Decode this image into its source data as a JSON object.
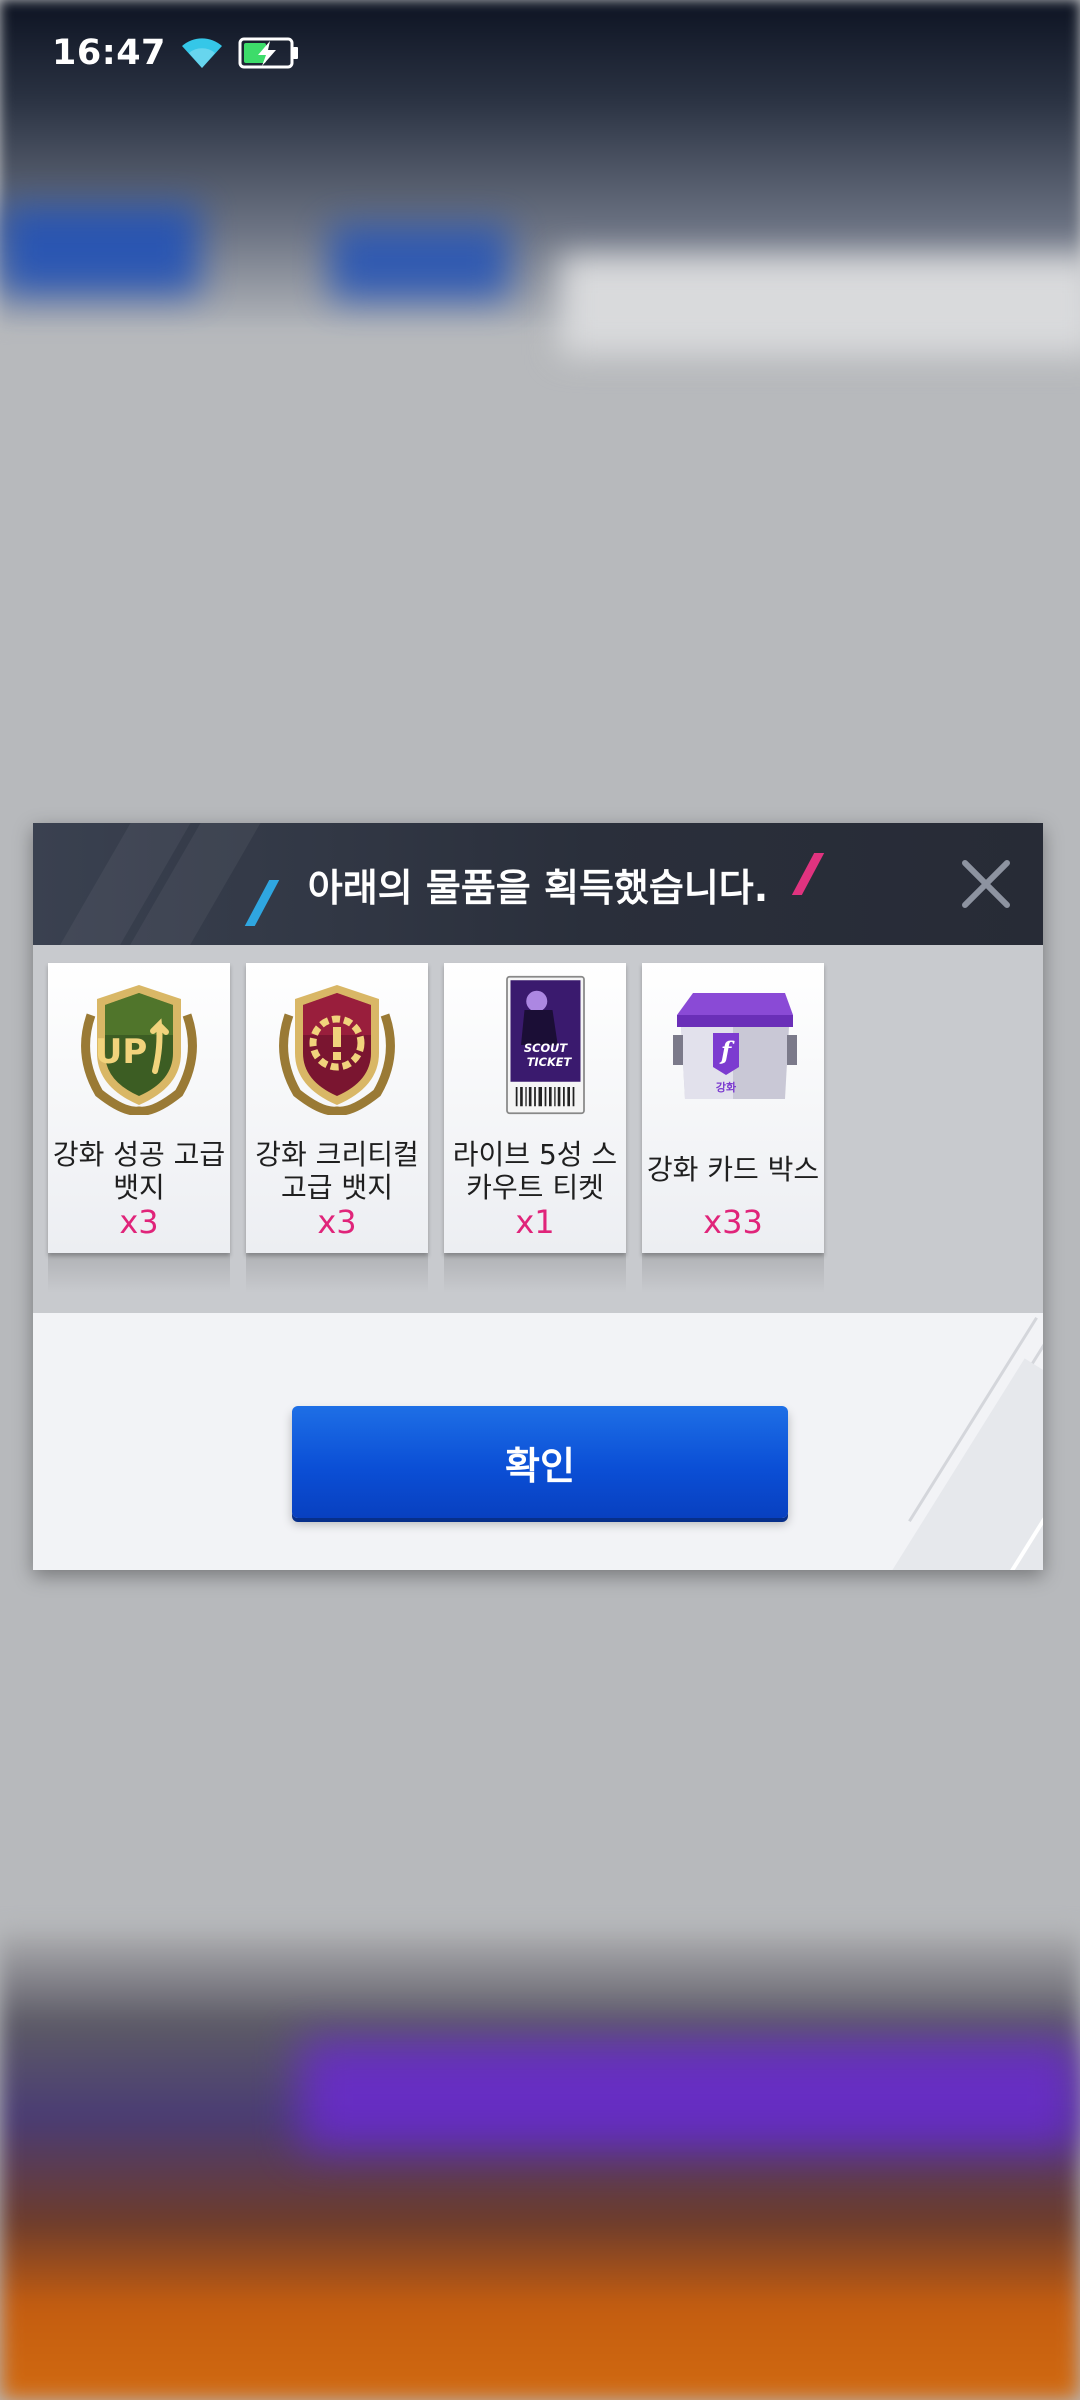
{
  "status_bar": {
    "time": "16:47",
    "icons": [
      "wifi-icon",
      "battery-charging-icon"
    ]
  },
  "dialog": {
    "title": "아래의 물품을 획득했습니다.",
    "close_icon": "close-icon",
    "items": [
      {
        "name": "강화 성공 고급 뱃지",
        "quantity": "x3",
        "icon": "upgrade-success-badge-icon"
      },
      {
        "name": "강화 크리티컬 고급 뱃지",
        "quantity": "x3",
        "icon": "upgrade-critical-badge-icon"
      },
      {
        "name": "라이브 5성 스카우트 티켓",
        "quantity": "x1",
        "icon": "scout-ticket-icon",
        "ticket_text": [
          "SCOUT",
          "TICKET"
        ]
      },
      {
        "name": "강화 카드 박스",
        "quantity": "x33",
        "icon": "upgrade-card-box-icon",
        "box_label": "강화"
      }
    ],
    "confirm_label": "확인"
  },
  "colors": {
    "header_bg": "#2a2f3b",
    "accent_blue": "#2fa6e0",
    "accent_pink": "#e0337f",
    "quantity": "#e0247a",
    "confirm_button": "#0b4fd6"
  }
}
